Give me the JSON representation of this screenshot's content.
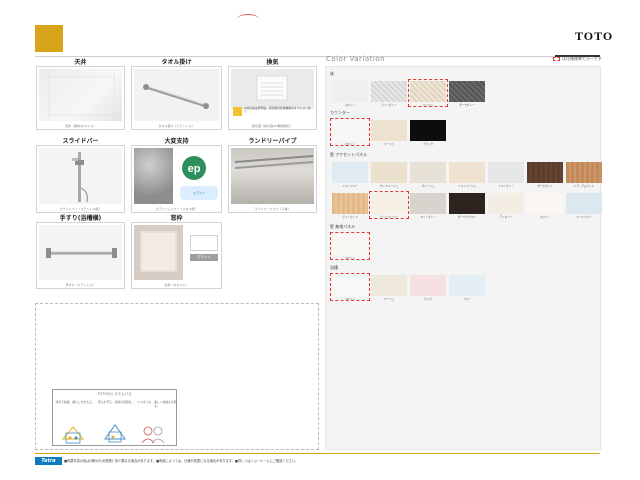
{
  "brand": "TOTO",
  "color_variation_title": "Color Variation",
  "legend_label": "は仕様標準カラーです",
  "equipment": [
    {
      "title": "天井",
      "caption": "天井（素材/ホワイト）"
    },
    {
      "title": "タオル掛け",
      "caption": "タオル掛け（ステンレス）"
    },
    {
      "title": "換気",
      "caption": "換気扇（換気扇/24時間換気）",
      "note": "※換気扇は標準品。浴室暖房乾燥機等のオプションあり"
    },
    {
      "title": "スライドバー",
      "caption": "スライドバー（ステンレス調）"
    },
    {
      "title": "大変支持",
      "caption": "エアインシャワー（メタル調）",
      "badge_text": "エアイン"
    },
    {
      "title": "ランドリーパイプ",
      "caption": "ランドリーパイプ（２本）"
    },
    {
      "title": "手すり(浴槽横)",
      "caption": "手すり（ステンレス）"
    },
    {
      "title": "窓枠",
      "caption": "窓枠（ホワイト）",
      "tag": "ホワイト"
    }
  ],
  "color_sections": [
    {
      "label": "床",
      "swatches": [
        {
          "name": "ホワイト",
          "color": "#efefef"
        },
        {
          "name": "ライトグレー",
          "color": "#dcdcdc"
        },
        {
          "name": "ベージュ",
          "color": "#e7dccb"
        },
        {
          "name": "ダークグレー",
          "color": "#5e5e5e"
        }
      ]
    },
    {
      "label": "カウンター",
      "swatches": [
        {
          "name": "ホワイト",
          "color": "#f7f7f5"
        },
        {
          "name": "ベージュ",
          "color": "#ede2cf"
        },
        {
          "name": "ブラック",
          "color": "#0d0d0d"
        }
      ]
    },
    {
      "label": "壁 アクセントパネル",
      "swatches": [
        {
          "name": "ミストブルー",
          "color": "#dfeaf1"
        },
        {
          "name": "サンドベージュ",
          "color": "#ebe1ce"
        },
        {
          "name": "グレージュ",
          "color": "#e8e1d5"
        },
        {
          "name": "ミストベージュ",
          "color": "#efe2d0"
        },
        {
          "name": "ミストグレー",
          "color": "#e7e7e7"
        },
        {
          "name": "ダークウッド",
          "color": "#5a3d2a"
        },
        {
          "name": "ミディアムウッド",
          "color": "#c28a5a"
        },
        {
          "name": "ライトウッド",
          "color": "#e3b98a"
        },
        {
          "name": "ライトベージュ",
          "color": "#f5efe4"
        },
        {
          "name": "マットグレー",
          "color": "#d7d3cd"
        },
        {
          "name": "ダークブラウン",
          "color": "#2e241f"
        },
        {
          "name": "アイボリー",
          "color": "#f3ede4"
        },
        {
          "name": "ホワイト",
          "color": "#faf7f3"
        },
        {
          "name": "ペールブルー",
          "color": "#dbe8f0"
        }
      ]
    },
    {
      "label": "壁 無地パネル",
      "swatches": [
        {
          "name": "ホワイト",
          "color": "#f7f6f2"
        }
      ]
    },
    {
      "label": "浴槽",
      "swatches": [
        {
          "name": "ホワイト",
          "color": "#f8f8f6"
        },
        {
          "name": "ベージュ",
          "color": "#efe8dc"
        },
        {
          "name": "ピンク",
          "color": "#f6e1e2"
        },
        {
          "name": "ブルー",
          "color": "#e2eef1"
        }
      ]
    }
  ],
  "info_box": {
    "title": "TOTOのシステムバス",
    "col1": "清潔で快適、暮らしを支える。",
    "col2": "安心を守る、家族の笑顔を。",
    "col3": "いつまでも、美しく快適な空間を。"
  },
  "footer": {
    "logo": "Tetra",
    "notes": "■掲載写真の色は印刷のため実物と多少異なる場合があります。■商品によっては、仕様が変更になる場合があります。■詳しくはショールームにご確認ください。"
  }
}
